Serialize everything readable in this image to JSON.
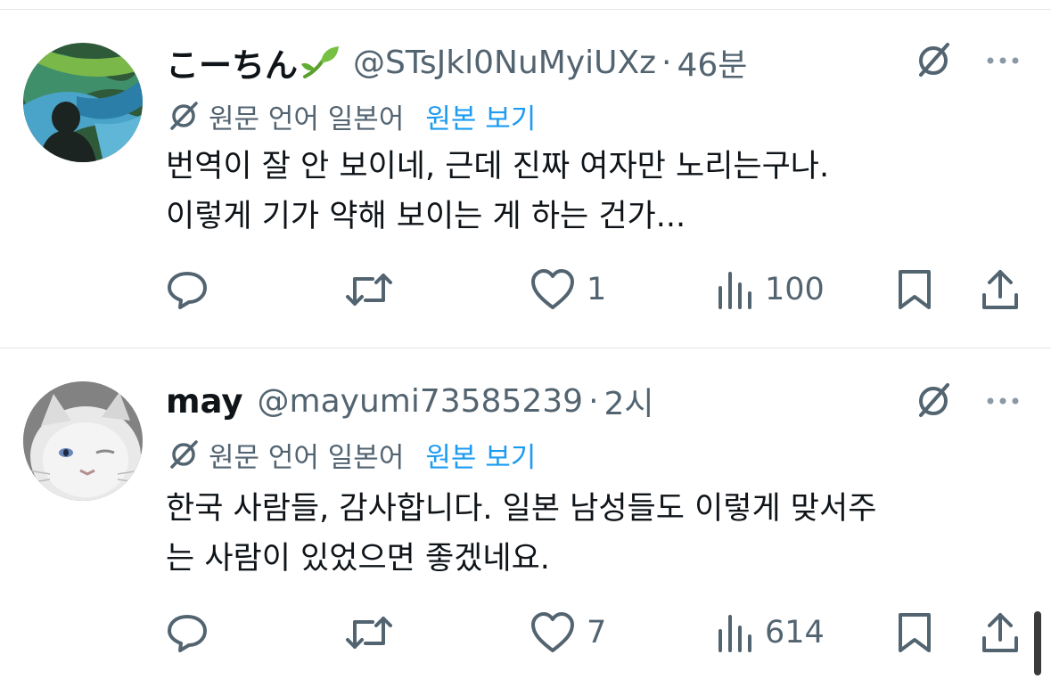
{
  "tweets": [
    {
      "name": "こーちん",
      "handle": "@STsJkl0NuMyiUXz",
      "separator": "·",
      "time": "46분",
      "translate": {
        "original_language": "원문 언어 일본어",
        "view_original": "원본 보기"
      },
      "body_lines": [
        "번역이 잘 안 보이네, 근데 진짜 여자만 노리는구나.",
        "이렇게 기가 약해 보이는 게 하는 건가..."
      ],
      "stats": {
        "replies": "",
        "retweets": "",
        "likes": "1",
        "views": "100"
      },
      "avatar_icon": "aurora-silhouette-avatar",
      "name_emoji": "seedling-icon"
    },
    {
      "name": "may",
      "handle": "@mayumi73585239",
      "separator": "·",
      "time": "2시",
      "translate": {
        "original_language": "원문 언어 일본어",
        "view_original": "원본 보기"
      },
      "body_lines": [
        "한국 사람들, 감사합니다. 일본 남성들도 이렇게 맞서주",
        "는 사람이 있었으면 좋겠네요."
      ],
      "stats": {
        "replies": "",
        "retweets": "",
        "likes": "7",
        "views": "614"
      },
      "avatar_icon": "white-cat-avatar"
    }
  ],
  "colors": {
    "text_primary": "#0f1419",
    "text_secondary": "#536471",
    "link": "#1d9bf0",
    "divider": "#e3e6e9"
  }
}
